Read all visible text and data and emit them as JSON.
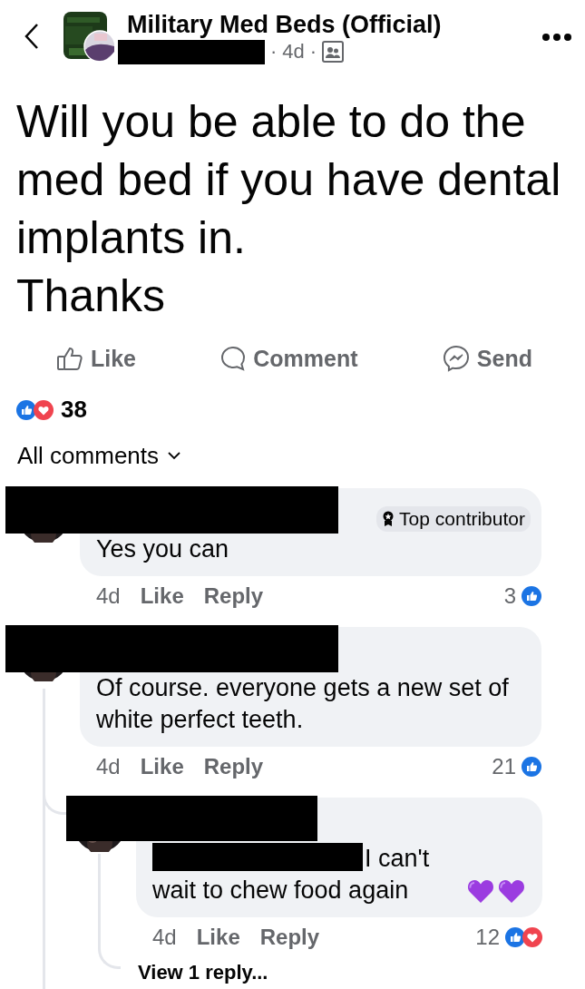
{
  "header": {
    "group_name": "Military Med Beds (Official)",
    "time": "4d",
    "separator": "·"
  },
  "post": {
    "text": "Will you be able to do the med bed if you have dental implants in.\nThanks"
  },
  "actions": [
    {
      "kind": "like",
      "label": "Like"
    },
    {
      "kind": "comment",
      "label": "Comment"
    },
    {
      "kind": "send",
      "label": "Send"
    }
  ],
  "reactions": {
    "icons": [
      {
        "kind": "like"
      },
      {
        "kind": "love"
      }
    ],
    "count": "38"
  },
  "comments_filter": {
    "label": "All comments"
  },
  "comments": [
    {
      "badge": "Top contributor",
      "text": "Yes you can",
      "time": "4d",
      "like": "Like",
      "reply": "Reply",
      "count": "3",
      "reactions": [
        {
          "kind": "like"
        }
      ]
    },
    {
      "text": "Of course. everyone gets a new set of white perfect teeth.",
      "time": "4d",
      "like": "Like",
      "reply": "Reply",
      "count": "21",
      "reactions": [
        {
          "kind": "like"
        }
      ],
      "children": [
        {
          "mention": true,
          "text": "I can't wait to chew food again",
          "emoji": [
            {
              "kind": "purple_heart"
            },
            {
              "kind": "purple_heart"
            }
          ],
          "time": "4d",
          "like": "Like",
          "reply": "Reply",
          "count": "12",
          "reactions": [
            {
              "kind": "like"
            },
            {
              "kind": "love"
            }
          ],
          "more": "View 1 reply..."
        }
      ]
    }
  ]
}
